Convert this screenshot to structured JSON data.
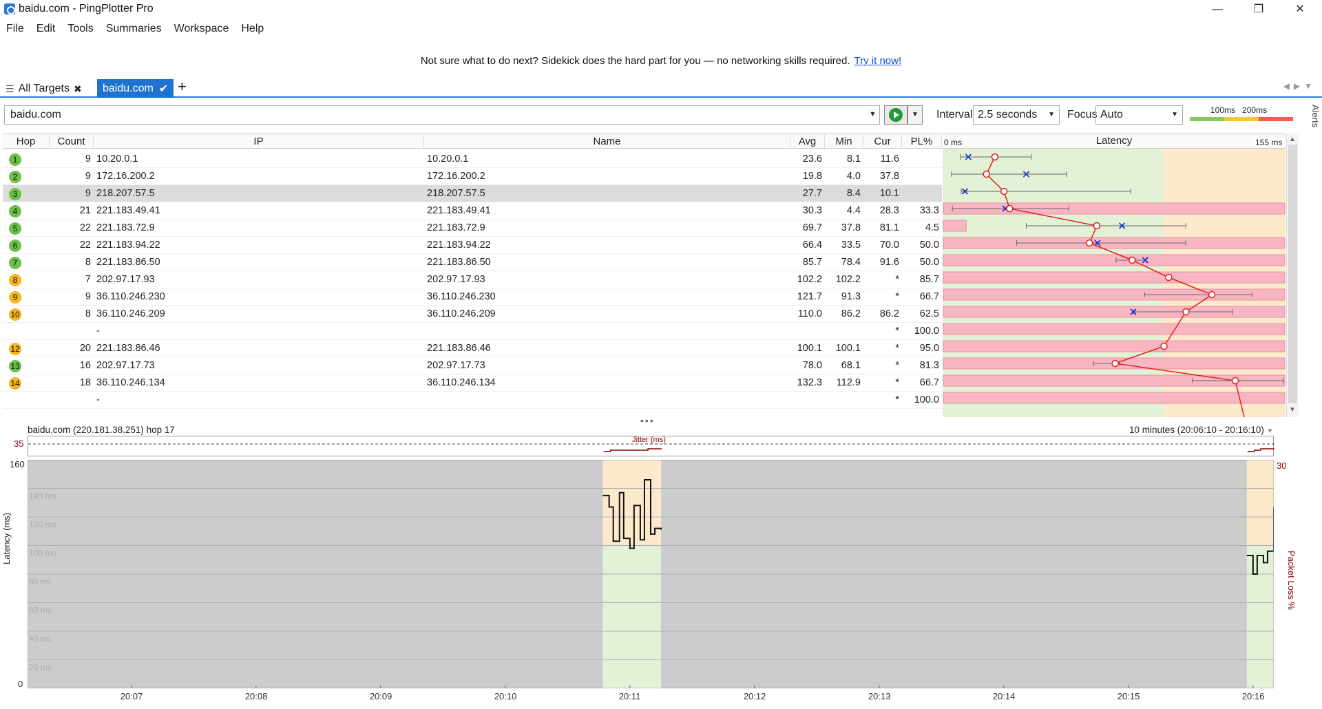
{
  "window": {
    "title": "baidu.com - PingPlotter Pro",
    "minimize": "—",
    "restore": "❐",
    "close": "✕"
  },
  "menu": [
    "File",
    "Edit",
    "Tools",
    "Summaries",
    "Workspace",
    "Help"
  ],
  "promo": {
    "text": "Not sure what to do next? Sidekick does the hard part for you — no networking skills required.",
    "link": "Try it now!"
  },
  "tabs": {
    "all_label": "All Targets",
    "active_label": "baidu.com",
    "add": "+"
  },
  "toolbar": {
    "target_value": "baidu.com",
    "interval_label": "Interval",
    "interval_value": "2.5 seconds",
    "focus_label": "Focus",
    "focus_value": "Auto",
    "scale_100": "100ms",
    "scale_200": "200ms",
    "alerts": "Alerts"
  },
  "columns": {
    "hop": "Hop",
    "count": "Count",
    "ip": "IP",
    "name": "Name",
    "avg": "Avg",
    "min": "Min",
    "cur": "Cur",
    "pl": "PL%",
    "latency": "Latency",
    "lat_min": "0 ms",
    "lat_max": "155 ms"
  },
  "hops": [
    {
      "hop": "1",
      "status": "green",
      "count": "9",
      "ip": "10.20.0.1",
      "name": "10.20.0.1",
      "avg": "23.6",
      "min": "8.1",
      "cur": "11.6",
      "pl": "",
      "avg_ms": 23.6,
      "min_ms": 8.1,
      "max_ms": 40,
      "cur_ms": 11.6,
      "loss": 0
    },
    {
      "hop": "2",
      "status": "green",
      "count": "9",
      "ip": "172.16.200.2",
      "name": "172.16.200.2",
      "avg": "19.8",
      "min": "4.0",
      "cur": "37.8",
      "pl": "",
      "avg_ms": 19.8,
      "min_ms": 4.0,
      "max_ms": 56,
      "cur_ms": 37.8,
      "loss": 0
    },
    {
      "hop": "3",
      "status": "green",
      "count": "9",
      "ip": "218.207.57.5",
      "name": "218.207.57.5",
      "avg": "27.7",
      "min": "8.4",
      "cur": "10.1",
      "pl": "",
      "avg_ms": 27.7,
      "min_ms": 8.4,
      "max_ms": 85,
      "cur_ms": 10.1,
      "loss": 0
    },
    {
      "hop": "4",
      "status": "green",
      "count": "21",
      "ip": "221.183.49.41",
      "name": "221.183.49.41",
      "avg": "30.3",
      "min": "4.4",
      "cur": "28.3",
      "pl": "33.3",
      "avg_ms": 30.3,
      "min_ms": 4.4,
      "max_ms": 57,
      "cur_ms": 28.3,
      "loss": 33.3
    },
    {
      "hop": "5",
      "status": "green",
      "count": "22",
      "ip": "221.183.72.9",
      "name": "221.183.72.9",
      "avg": "69.7",
      "min": "37.8",
      "cur": "81.1",
      "pl": "4.5",
      "avg_ms": 69.7,
      "min_ms": 37.8,
      "max_ms": 110,
      "cur_ms": 81.1,
      "loss": 4.5
    },
    {
      "hop": "6",
      "status": "green",
      "count": "22",
      "ip": "221.183.94.22",
      "name": "221.183.94.22",
      "avg": "66.4",
      "min": "33.5",
      "cur": "70.0",
      "pl": "50.0",
      "avg_ms": 66.4,
      "min_ms": 33.5,
      "max_ms": 110,
      "cur_ms": 70.0,
      "loss": 50.0
    },
    {
      "hop": "7",
      "status": "green",
      "count": "8",
      "ip": "221.183.86.50",
      "name": "221.183.86.50",
      "avg": "85.7",
      "min": "78.4",
      "cur": "91.6",
      "pl": "50.0",
      "avg_ms": 85.7,
      "min_ms": 78.4,
      "max_ms": 92,
      "cur_ms": 91.6,
      "loss": 50.0
    },
    {
      "hop": "8",
      "status": "orange",
      "count": "7",
      "ip": "202.97.17.93",
      "name": "202.97.17.93",
      "avg": "102.2",
      "min": "102.2",
      "cur": "*",
      "pl": "85.7",
      "avg_ms": 102.2,
      "min_ms": 102.2,
      "max_ms": 102.2,
      "cur_ms": null,
      "loss": 85.7
    },
    {
      "hop": "9",
      "status": "orange",
      "count": "9",
      "ip": "36.110.246.230",
      "name": "36.110.246.230",
      "avg": "121.7",
      "min": "91.3",
      "cur": "*",
      "pl": "66.7",
      "avg_ms": 121.7,
      "min_ms": 91.3,
      "max_ms": 140,
      "cur_ms": null,
      "loss": 66.7
    },
    {
      "hop": "10",
      "status": "orange",
      "count": "8",
      "ip": "36.110.246.209",
      "name": "36.110.246.209",
      "avg": "110.0",
      "min": "86.2",
      "cur": "86.2",
      "pl": "62.5",
      "avg_ms": 110.0,
      "min_ms": 86.2,
      "max_ms": 131,
      "cur_ms": 86.2,
      "loss": 62.5
    },
    {
      "hop": "",
      "status": "none",
      "count": "",
      "ip": "-",
      "name": "",
      "avg": "",
      "min": "",
      "cur": "*",
      "pl": "100.0",
      "avg_ms": null,
      "min_ms": null,
      "max_ms": null,
      "cur_ms": null,
      "loss": 100
    },
    {
      "hop": "12",
      "status": "orange",
      "count": "20",
      "ip": "221.183.86.46",
      "name": "221.183.86.46",
      "avg": "100.1",
      "min": "100.1",
      "cur": "*",
      "pl": "95.0",
      "avg_ms": 100.1,
      "min_ms": 100.1,
      "max_ms": 100.1,
      "cur_ms": null,
      "loss": 95.0
    },
    {
      "hop": "13",
      "status": "green",
      "count": "16",
      "ip": "202.97.17.73",
      "name": "202.97.17.73",
      "avg": "78.0",
      "min": "68.1",
      "cur": "*",
      "pl": "81.3",
      "avg_ms": 78.0,
      "min_ms": 68.1,
      "max_ms": 80,
      "cur_ms": null,
      "loss": 81.3
    },
    {
      "hop": "14",
      "status": "orange",
      "count": "18",
      "ip": "36.110.246.134",
      "name": "36.110.246.134",
      "avg": "132.3",
      "min": "112.9",
      "cur": "*",
      "pl": "66.7",
      "avg_ms": 132.3,
      "min_ms": 112.9,
      "max_ms": 154,
      "cur_ms": null,
      "loss": 66.7
    },
    {
      "hop": "",
      "status": "none",
      "count": "",
      "ip": "-",
      "name": "",
      "avg": "",
      "min": "",
      "cur": "*",
      "pl": "100.0",
      "avg_ms": null,
      "min_ms": null,
      "max_ms": null,
      "cur_ms": null,
      "loss": 100
    }
  ],
  "graph": {
    "title": "baidu.com (220.181.38.251) hop 17",
    "range": "10 minutes (20:06:10 - 20:16:10)",
    "jitter_label": "Jitter (ms)",
    "jitter_max": "35",
    "y_max": "160",
    "y_min": "0",
    "y2_max": "30",
    "ylabel": "Latency (ms)",
    "y2label": "Packet Loss %",
    "gridlines": [
      "140 ms",
      "120 ms",
      "100 ms",
      "80 ms",
      "60 ms",
      "40 ms",
      "20 ms"
    ],
    "xticks": [
      "20:07",
      "20:08",
      "20:09",
      "20:10",
      "20:11",
      "20:12",
      "20:13",
      "20:14",
      "20:15",
      "20:16"
    ]
  },
  "chart_data": {
    "type": "line",
    "title": "baidu.com (220.181.38.251) hop 17",
    "xlabel": "",
    "ylabel": "Latency (ms)",
    "ylim": [
      0,
      160
    ],
    "y2label": "Packet Loss %",
    "y2lim": [
      0,
      30
    ],
    "x_domain": [
      "20:06:10",
      "20:16:10"
    ],
    "series": [
      {
        "segment": 1,
        "x": [
          "20:10:47",
          "20:10:50",
          "20:10:52",
          "20:10:55",
          "20:10:57",
          "20:11:00",
          "20:11:02",
          "20:11:05",
          "20:11:07",
          "20:11:10",
          "20:11:12",
          "20:11:15"
        ],
        "values": [
          135,
          127,
          103,
          137,
          105,
          98,
          128,
          104,
          146,
          108,
          112,
          111
        ]
      },
      {
        "segment": 2,
        "x": [
          "20:15:57",
          "20:16:00",
          "20:16:02",
          "20:16:05",
          "20:16:07",
          "20:16:10"
        ],
        "values": [
          93,
          80,
          93,
          88,
          96,
          127
        ]
      }
    ],
    "grid": true
  }
}
